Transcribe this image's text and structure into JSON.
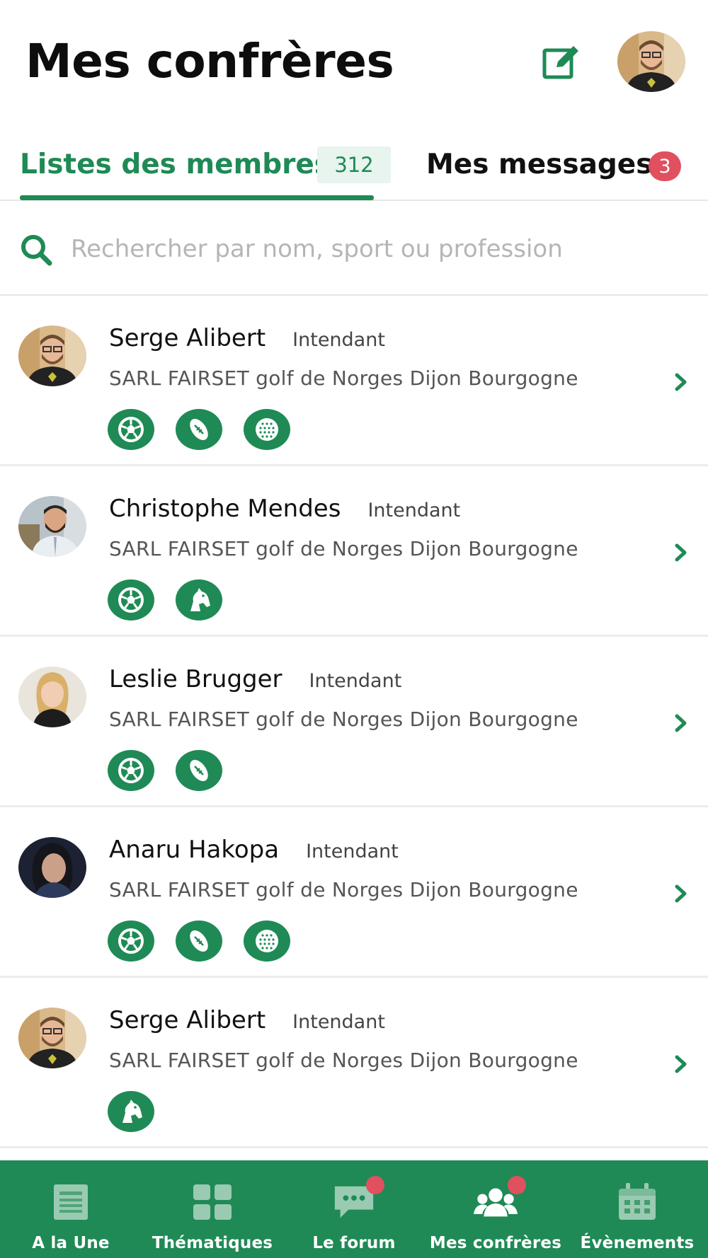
{
  "header": {
    "title": "Mes confrères",
    "edit_icon": "edit-icon"
  },
  "tabs": {
    "members": {
      "label": "Listes des membres",
      "count": "312"
    },
    "messages": {
      "label": "Mes messages",
      "badge": "3"
    }
  },
  "search": {
    "placeholder": "Rechercher par nom, sport ou profession",
    "value": ""
  },
  "members": [
    {
      "name": "Serge Alibert",
      "role": "Intendant",
      "company": "SARL FAIRSET golf de Norges Dijon Bourgogne",
      "avatar": "man-glasses-beard",
      "sports": [
        "soccer",
        "rugby",
        "golf"
      ]
    },
    {
      "name": "Christophe Mendes",
      "role": "Intendant",
      "company": "SARL FAIRSET golf de Norges Dijon Bourgogne",
      "avatar": "man-beard-shirt",
      "sports": [
        "soccer",
        "horse"
      ]
    },
    {
      "name": "Leslie Brugger",
      "role": "Intendant",
      "company": "SARL FAIRSET golf de Norges Dijon Bourgogne",
      "avatar": "woman-blonde",
      "sports": [
        "soccer",
        "rugby"
      ]
    },
    {
      "name": "Anaru Hakopa",
      "role": "Intendant",
      "company": "SARL FAIRSET golf de Norges Dijon Bourgogne",
      "avatar": "woman-dark-hair",
      "sports": [
        "soccer",
        "rugby",
        "golf"
      ]
    },
    {
      "name": "Serge Alibert",
      "role": "Intendant",
      "company": "SARL FAIRSET golf de Norges Dijon Bourgogne",
      "avatar": "man-glasses-beard",
      "sports": [
        "horse"
      ]
    }
  ],
  "nav": [
    {
      "label": "A la Une",
      "icon": "newspaper-icon",
      "dot": false
    },
    {
      "label": "Thématiques",
      "icon": "grid-icon",
      "dot": false
    },
    {
      "label": "Le forum",
      "icon": "chat-icon",
      "dot": true
    },
    {
      "label": "Mes confrères",
      "icon": "users-icon",
      "dot": true
    },
    {
      "label": "Évènements",
      "icon": "calendar-icon",
      "dot": false
    }
  ],
  "colors": {
    "brand": "#1f8a55",
    "badge": "#e0505f"
  }
}
